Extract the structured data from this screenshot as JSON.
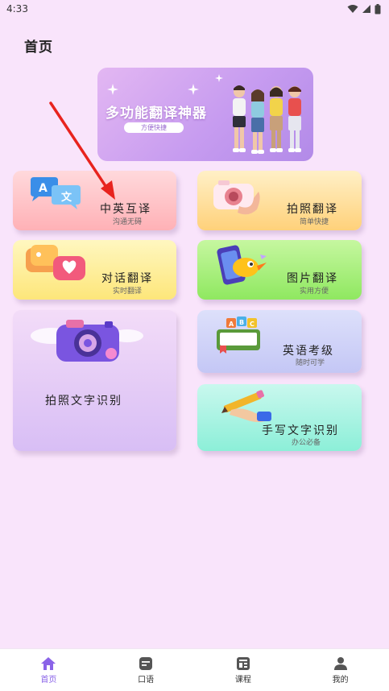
{
  "status_bar": {
    "time": "4:33"
  },
  "header": {
    "title": "首页"
  },
  "banner": {
    "title": "多功能翻译神器",
    "subtitle": "方便快捷"
  },
  "cards": {
    "cn_en": {
      "title": "中英互译",
      "subtitle": "沟通无碍"
    },
    "photo": {
      "title": "拍照翻译",
      "subtitle": "简单快捷"
    },
    "dialog": {
      "title": "对话翻译",
      "subtitle": "实时翻译"
    },
    "image": {
      "title": "图片翻译",
      "subtitle": "实用方便"
    },
    "ocr": {
      "title": "拍照文字识别"
    },
    "exam": {
      "title": "英语考级",
      "subtitle": "随时可学"
    },
    "handwriting": {
      "title": "手写文字识别",
      "subtitle": "办公必备"
    }
  },
  "nav": {
    "items": [
      {
        "label": "首页",
        "icon": "home-icon",
        "active": true
      },
      {
        "label": "口语",
        "icon": "speech-icon",
        "active": false
      },
      {
        "label": "课程",
        "icon": "course-icon",
        "active": false
      },
      {
        "label": "我的",
        "icon": "user-icon",
        "active": false
      }
    ]
  },
  "colors": {
    "accent": "#8a63e8",
    "background": "#f9e4fb"
  }
}
